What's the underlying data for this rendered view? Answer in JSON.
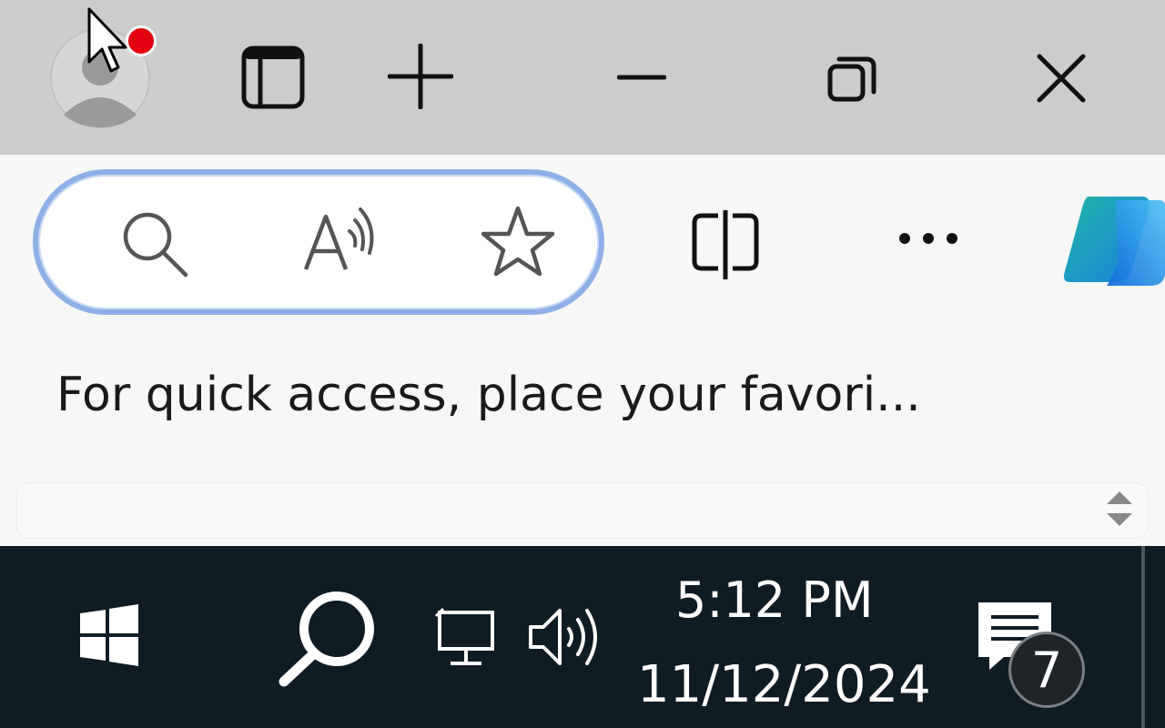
{
  "titlebar": {
    "profile": {
      "icon": "profile-avatar-icon",
      "notification": true,
      "notification_color": "#e3000f"
    },
    "buttons": [
      {
        "name": "vertical-tabs-button",
        "icon": "sidebar-panel-icon"
      },
      {
        "name": "new-tab-button",
        "icon": "plus-icon"
      },
      {
        "name": "minimize-button",
        "icon": "minimize-icon"
      },
      {
        "name": "restore-button",
        "icon": "restore-icon"
      },
      {
        "name": "close-button",
        "icon": "close-icon"
      }
    ]
  },
  "toolbar": {
    "address_bar_icons": [
      "search-icon",
      "read-aloud-icon",
      "favorite-star-icon"
    ],
    "split_screen_icon": "split-screen-icon",
    "more_icon": "more-ellipsis-icon",
    "copilot_icon": "copilot-icon",
    "accent_color": "#8fb0e6"
  },
  "favorites_bar": {
    "message": "For quick access, place your favori..."
  },
  "taskbar": {
    "start_icon": "windows-start-icon",
    "search_icon": "taskbar-search-icon",
    "network_icon": "network-icon",
    "volume_icon": "volume-icon",
    "clock": {
      "time": "5:12 PM",
      "date": "11/12/2024"
    },
    "notifications": {
      "icon": "notification-center-icon",
      "count": "7"
    },
    "background": "#0f1c24"
  }
}
